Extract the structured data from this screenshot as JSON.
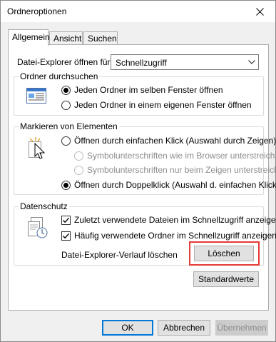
{
  "window": {
    "title": "Ordneroptionen"
  },
  "tabs": [
    {
      "label": "Allgemein",
      "active": true
    },
    {
      "label": "Ansicht",
      "active": false
    },
    {
      "label": "Suchen",
      "active": false
    }
  ],
  "open_explorer": {
    "label": "Datei-Explorer öffnen für:",
    "value": "Schnellzugriff"
  },
  "browse_folders": {
    "title": "Ordner durchsuchen",
    "options": [
      {
        "label": "Jeden Ordner im selben Fenster öffnen",
        "checked": true
      },
      {
        "label": "Jeden Ordner in einem eigenen Fenster öffnen",
        "checked": false
      }
    ]
  },
  "click_items": {
    "title": "Markieren von Elementen",
    "options": [
      {
        "label": "Öffnen durch einfachen Klick (Auswahl durch Zeigen)",
        "checked": false,
        "enabled": true
      },
      {
        "label": "Symbolunterschriften wie im Browser unterstreichen",
        "checked": false,
        "enabled": false
      },
      {
        "label": "Symbolunterschriften nur beim Zeigen unterstreichen",
        "checked": false,
        "enabled": false
      },
      {
        "label": "Öffnen durch Doppelklick (Auswahl d. einfachen Klick)",
        "checked": true,
        "enabled": true
      }
    ]
  },
  "privacy": {
    "title": "Datenschutz",
    "options": [
      {
        "label": "Zuletzt verwendete Dateien im Schnellzugriff anzeigen",
        "checked": true
      },
      {
        "label": "Häufig verwendete Ordner im Schnellzugriff anzeigen",
        "checked": true
      }
    ],
    "clear_label": "Datei-Explorer-Verlauf löschen",
    "clear_button": "Löschen"
  },
  "defaults_button": "Standardwerte",
  "footer": {
    "ok": "OK",
    "cancel": "Abbrechen",
    "apply": "Übernehmen"
  },
  "colors": {
    "highlight": "#e53935",
    "accent": "#0078d7"
  }
}
